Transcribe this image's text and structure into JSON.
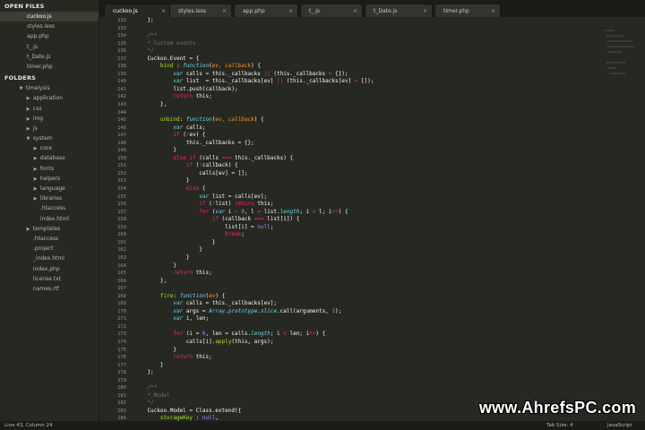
{
  "sidebar": {
    "open_files_title": "OPEN FILES",
    "open_files": [
      "cuckoo.js",
      "styles.less",
      "app.php",
      "t_.js",
      "t_Date.js",
      "timer.php"
    ],
    "folders_title": "FOLDERS",
    "tree": [
      {
        "label": "timelysis",
        "depth": 0,
        "arrow": "▼"
      },
      {
        "label": "application",
        "depth": 1,
        "arrow": "▶"
      },
      {
        "label": "css",
        "depth": 1,
        "arrow": "▶"
      },
      {
        "label": "img",
        "depth": 1,
        "arrow": "▶"
      },
      {
        "label": "js",
        "depth": 1,
        "arrow": "▶"
      },
      {
        "label": "system",
        "depth": 1,
        "arrow": "▼"
      },
      {
        "label": "core",
        "depth": 2,
        "arrow": "▶"
      },
      {
        "label": "database",
        "depth": 2,
        "arrow": "▶"
      },
      {
        "label": "fonts",
        "depth": 2,
        "arrow": "▶"
      },
      {
        "label": "helpers",
        "depth": 2,
        "arrow": "▶"
      },
      {
        "label": "language",
        "depth": 2,
        "arrow": "▶"
      },
      {
        "label": "libraries",
        "depth": 2,
        "arrow": "▶"
      },
      {
        "label": ".htaccess",
        "depth": 2,
        "arrow": ""
      },
      {
        "label": "index.html",
        "depth": 2,
        "arrow": ""
      },
      {
        "label": "templates",
        "depth": 1,
        "arrow": "▶"
      },
      {
        "label": ".htaccess",
        "depth": 1,
        "arrow": ""
      },
      {
        "label": ".project",
        "depth": 1,
        "arrow": ""
      },
      {
        "label": "_index.html",
        "depth": 1,
        "arrow": ""
      },
      {
        "label": "index.php",
        "depth": 1,
        "arrow": ""
      },
      {
        "label": "license.txt",
        "depth": 1,
        "arrow": ""
      },
      {
        "label": "names.rtf",
        "depth": 1,
        "arrow": ""
      }
    ]
  },
  "tabs": [
    {
      "label": "cuckoo.js",
      "close": "×"
    },
    {
      "label": "styles.less",
      "close": "×"
    },
    {
      "label": "app.php",
      "close": "×"
    },
    {
      "label": "t_.js",
      "close": "×"
    },
    {
      "label": "t_Date.js",
      "close": "×"
    },
    {
      "label": "timer.php",
      "close": "×"
    }
  ],
  "editor": {
    "line_numbers": [
      "132",
      "133",
      "134",
      "135",
      "136",
      "137",
      "138",
      "139",
      "140",
      "141",
      "142",
      "143",
      "144",
      "145",
      "146",
      "147",
      "148",
      "149",
      "150",
      "151",
      "152",
      "153",
      "154",
      "155",
      "156",
      "157",
      "158",
      "159",
      "160",
      "161",
      "162",
      "163",
      "164",
      "165",
      "166",
      "167",
      "168",
      "169",
      "170",
      "171",
      "172",
      "173",
      "174",
      "175",
      "176",
      "177",
      "178",
      "179",
      "180",
      "181",
      "182",
      "183",
      "184",
      "185"
    ],
    "lines": [
      [
        [
          "p",
          "    };"
        ]
      ],
      [],
      [
        [
          "cm",
          "    /**"
        ]
      ],
      [
        [
          "cm",
          "    * Custom events"
        ]
      ],
      [
        [
          "cm",
          "    */"
        ]
      ],
      [
        [
          "p",
          "    Cuckoo.Event = {"
        ]
      ],
      [
        [
          "p",
          "        "
        ],
        [
          "fn",
          "bind"
        ],
        [
          "p",
          " : "
        ],
        [
          "sf",
          "function"
        ],
        [
          "p",
          "("
        ],
        [
          "pa",
          "ev, callback"
        ],
        [
          "p",
          ") {"
        ]
      ],
      [
        [
          "p",
          "            "
        ],
        [
          "sf",
          "var"
        ],
        [
          "p",
          " calls = this._callbacks "
        ],
        [
          "kw",
          "||"
        ],
        [
          "p",
          " (this._callbacks "
        ],
        [
          "kw",
          "="
        ],
        [
          "p",
          " {});"
        ]
      ],
      [
        [
          "p",
          "            "
        ],
        [
          "sf",
          "var"
        ],
        [
          "p",
          " list  = this._callbacks[ev] "
        ],
        [
          "kw",
          "||"
        ],
        [
          "p",
          " (this._callbacks[ev] "
        ],
        [
          "kw",
          "="
        ],
        [
          "p",
          " []);"
        ]
      ],
      [
        [
          "p",
          "            list.push(callback);"
        ]
      ],
      [
        [
          "p",
          "            "
        ],
        [
          "kw",
          "return"
        ],
        [
          "p",
          " this;"
        ]
      ],
      [
        [
          "p",
          "        },"
        ]
      ],
      [],
      [
        [
          "p",
          "        "
        ],
        [
          "fn",
          "unbind"
        ],
        [
          "p",
          ": "
        ],
        [
          "sf",
          "function"
        ],
        [
          "p",
          "("
        ],
        [
          "pa",
          "ev, callback"
        ],
        [
          "p",
          ") {"
        ]
      ],
      [
        [
          "p",
          "            "
        ],
        [
          "sf",
          "var"
        ],
        [
          "p",
          " calls;"
        ]
      ],
      [
        [
          "p",
          "            "
        ],
        [
          "kw",
          "if"
        ],
        [
          "p",
          " ("
        ],
        [
          "kw",
          "!"
        ],
        [
          "p",
          "ev) {"
        ]
      ],
      [
        [
          "p",
          "                this._callbacks = {};"
        ]
      ],
      [
        [
          "p",
          "            }"
        ]
      ],
      [
        [
          "p",
          "            "
        ],
        [
          "kw",
          "else if"
        ],
        [
          "p",
          " (calls "
        ],
        [
          "kw",
          "==="
        ],
        [
          "p",
          " this._callbacks) {"
        ]
      ],
      [
        [
          "p",
          "                "
        ],
        [
          "kw",
          "if"
        ],
        [
          "p",
          " ("
        ],
        [
          "kw",
          "!"
        ],
        [
          "p",
          "callback) {"
        ]
      ],
      [
        [
          "p",
          "                    calls[ev] = [];"
        ]
      ],
      [
        [
          "p",
          "                }"
        ]
      ],
      [
        [
          "p",
          "                "
        ],
        [
          "kw",
          "else"
        ],
        [
          "p",
          " {"
        ]
      ],
      [
        [
          "p",
          "                    "
        ],
        [
          "sf",
          "var"
        ],
        [
          "p",
          " list = calls[ev];"
        ]
      ],
      [
        [
          "p",
          "                    "
        ],
        [
          "kw",
          "if"
        ],
        [
          "p",
          " ("
        ],
        [
          "kw",
          "!"
        ],
        [
          "p",
          "list) "
        ],
        [
          "kw",
          "return"
        ],
        [
          "p",
          " this;"
        ]
      ],
      [
        [
          "p",
          "                    "
        ],
        [
          "kw",
          "for"
        ],
        [
          "p",
          " ("
        ],
        [
          "sf",
          "var"
        ],
        [
          "p",
          " i "
        ],
        [
          "kw",
          "="
        ],
        [
          "p",
          " "
        ],
        [
          "nm",
          "0"
        ],
        [
          "p",
          ", l "
        ],
        [
          "kw",
          "="
        ],
        [
          "p",
          " list."
        ],
        [
          "sf",
          "length"
        ],
        [
          "p",
          "; i "
        ],
        [
          "kw",
          "<"
        ],
        [
          "p",
          " l; i"
        ],
        [
          "kw",
          "++"
        ],
        [
          "p",
          ") {"
        ]
      ],
      [
        [
          "p",
          "                        "
        ],
        [
          "kw",
          "if"
        ],
        [
          "p",
          " (callback "
        ],
        [
          "kw",
          "==="
        ],
        [
          "p",
          " list[i]) {"
        ]
      ],
      [
        [
          "p",
          "                            list[i] = "
        ],
        [
          "nm",
          "null"
        ],
        [
          "p",
          ";"
        ]
      ],
      [
        [
          "p",
          "                            "
        ],
        [
          "kw",
          "break"
        ],
        [
          "p",
          ";"
        ]
      ],
      [
        [
          "p",
          "                        }"
        ]
      ],
      [
        [
          "p",
          "                    }"
        ]
      ],
      [
        [
          "p",
          "                }"
        ]
      ],
      [
        [
          "p",
          "            }"
        ]
      ],
      [
        [
          "p",
          "            "
        ],
        [
          "kw",
          "return"
        ],
        [
          "p",
          " this;"
        ]
      ],
      [
        [
          "p",
          "        },"
        ]
      ],
      [],
      [
        [
          "p",
          "        "
        ],
        [
          "fn",
          "fire"
        ],
        [
          "p",
          ": "
        ],
        [
          "sf",
          "function"
        ],
        [
          "p",
          "("
        ],
        [
          "pa",
          "ev"
        ],
        [
          "p",
          ") {"
        ]
      ],
      [
        [
          "p",
          "            "
        ],
        [
          "sf",
          "var"
        ],
        [
          "p",
          " calls = this._callbacks[ev];"
        ]
      ],
      [
        [
          "p",
          "            "
        ],
        [
          "sf",
          "var"
        ],
        [
          "p",
          " args = "
        ],
        [
          "sf",
          "Array"
        ],
        [
          "p",
          "."
        ],
        [
          "sf",
          "prototype"
        ],
        [
          "p",
          "."
        ],
        [
          "sf",
          "slice"
        ],
        [
          "p",
          ".call(arguments, "
        ],
        [
          "nm",
          "1"
        ],
        [
          "p",
          ");"
        ]
      ],
      [
        [
          "p",
          "            "
        ],
        [
          "sf",
          "var"
        ],
        [
          "p",
          " i, len;"
        ]
      ],
      [],
      [
        [
          "p",
          "            "
        ],
        [
          "kw",
          "for"
        ],
        [
          "p",
          " (i = "
        ],
        [
          "nm",
          "0"
        ],
        [
          "p",
          ", len = calls."
        ],
        [
          "sf",
          "length"
        ],
        [
          "p",
          "; i "
        ],
        [
          "kw",
          "<"
        ],
        [
          "p",
          " len; i"
        ],
        [
          "kw",
          "++"
        ],
        [
          "p",
          ") {"
        ]
      ],
      [
        [
          "p",
          "                calls[i]."
        ],
        [
          "fn",
          "apply"
        ],
        [
          "p",
          "(this, args);"
        ]
      ],
      [
        [
          "p",
          "            }"
        ]
      ],
      [
        [
          "p",
          "            "
        ],
        [
          "kw",
          "return"
        ],
        [
          "p",
          " this;"
        ]
      ],
      [
        [
          "p",
          "        }"
        ]
      ],
      [
        [
          "p",
          "    };"
        ]
      ],
      [],
      [
        [
          "cm",
          "    /**"
        ]
      ],
      [
        [
          "cm",
          "    * Model"
        ]
      ],
      [
        [
          "cm",
          "    */"
        ]
      ],
      [
        [
          "p",
          "    Cuckoo.Model = Class.extend({"
        ]
      ],
      [
        [
          "p",
          "        "
        ],
        [
          "fn",
          "storageKey"
        ],
        [
          "p",
          " : "
        ],
        [
          "nm",
          "null"
        ],
        [
          "p",
          ","
        ]
      ],
      [
        [
          "p",
          "        "
        ],
        [
          "fn",
          "storage"
        ],
        [
          "p",
          " : "
        ],
        [
          "nm",
          "null"
        ],
        [
          "p",
          ","
        ]
      ]
    ]
  },
  "statusbar": {
    "position": "Line 43, Column 24",
    "tab_size": "Tab Size: 4",
    "syntax": "JavaScript"
  },
  "watermark": "www.AhrefsPC.com"
}
